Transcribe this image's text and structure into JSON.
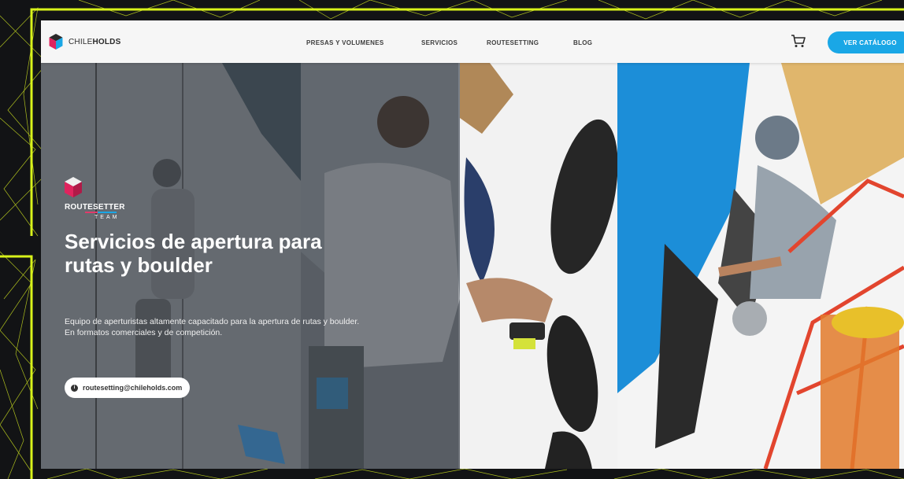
{
  "brand": {
    "name_light": "CHILE",
    "name_bold": "HOLDS"
  },
  "nav": {
    "items": [
      {
        "label": "PRESAS Y VOLUMENES"
      },
      {
        "label": "SERVICIOS"
      },
      {
        "label": "ROUTESETTING"
      },
      {
        "label": "BLOG"
      }
    ],
    "cta_label": "VER CATÁLOGO"
  },
  "icons": {
    "cart": "cart-icon",
    "info": "info-icon",
    "logo": "cube-logo-icon"
  },
  "hero": {
    "badge_light": "ROUTE",
    "badge_bold": "SETTER",
    "badge_sub": "TEAM",
    "title": "Servicios de apertura para rutas y boulder",
    "description": "Equipo de aperturistas altamente capacitado para la apertura de rutas y boulder. En formatos comerciales y de competición.",
    "email": "routesetting@chileholds.com"
  },
  "colors": {
    "accent": "#1aa7e6",
    "frame": "#d8f21a",
    "brand_red": "#e0245e"
  }
}
